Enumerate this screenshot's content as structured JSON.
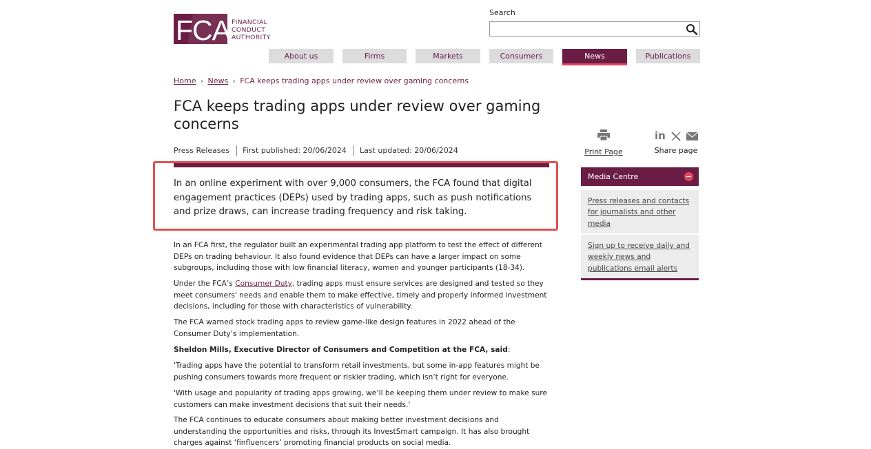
{
  "logo": {
    "mark": "FCA",
    "line1": "FINANCIAL",
    "line2": "CONDUCT",
    "line3": "AUTHORITY"
  },
  "search": {
    "label": "Search",
    "placeholder": "",
    "value": ""
  },
  "nav": {
    "items": [
      {
        "label": "About us"
      },
      {
        "label": "Firms"
      },
      {
        "label": "Markets"
      },
      {
        "label": "Consumers"
      },
      {
        "label": "News"
      },
      {
        "label": "Publications"
      }
    ],
    "active": "News"
  },
  "breadcrumb": {
    "home": "Home",
    "news": "News",
    "current": "FCA keeps trading apps under review over gaming concerns"
  },
  "article": {
    "title": "FCA keeps trading apps under review over gaming concerns",
    "category": "Press Releases",
    "first_published": "First published: 20/06/2024",
    "last_updated": "Last updated: 20/06/2024",
    "lead": "In an online experiment with over 9,000 consumers, the FCA found that digital engagement practices (DEPs) used by trading apps, such as push notifications and prize draws, can increase trading frequency and risk taking.",
    "p1": "In an FCA first, the regulator built an experimental trading app platform to test the effect of different DEPs on trading behaviour. It also found evidence that DEPs can have a larger impact on some subgroups, including those with low financial literacy, women and younger participants (18-34).",
    "p2_before": "Under the FCA’s ",
    "p2_link": "Consumer Duty",
    "p2_after": ", trading apps must ensure services are designed and tested so they meet consumers' needs and enable them to make effective, timely and properly informed investment decisions, including for those with characteristics of vulnerability.",
    "p3": "The FCA warned stock trading apps to review game-like design features in 2022 ahead of the Consumer Duty’s implementation.",
    "quote_speaker": "Sheldon Mills, Executive Director of Consumers and Competition at the FCA, said",
    "quote_colon": ":",
    "quote1": "'Trading apps have the potential to transform retail investments, but some in-app features might be pushing consumers towards more frequent or riskier trading, which isn’t right for everyone.",
    "quote2": "'With usage and popularity of trading apps growing, we’ll be keeping them under review to make sure customers can make investment decisions that suit their needs.'",
    "p4": "The FCA continues to educate consumers about making better investment decisions and understanding the opportunities and risks, through its InvestSmart campaign. It has also brought charges against ‘finfluencers’ promoting financial products on social media."
  },
  "tools": {
    "print_label": "Print Page",
    "share_label": "Share page",
    "linkedin_glyph": "in"
  },
  "sidebar": {
    "title": "Media Centre",
    "links": [
      {
        "label": "Press releases and contacts for journalists and other media"
      },
      {
        "label": "Sign up to receive daily and weekly news and publications email alerts"
      }
    ]
  },
  "colors": {
    "brand": "#6b1d45",
    "accent": "#e1475e",
    "highlight_border": "#e05252",
    "nav_bg": "#dcdcdc"
  },
  "icons": [
    "search-icon",
    "printer-icon",
    "linkedin-icon",
    "x-icon",
    "email-icon",
    "minus-icon"
  ]
}
